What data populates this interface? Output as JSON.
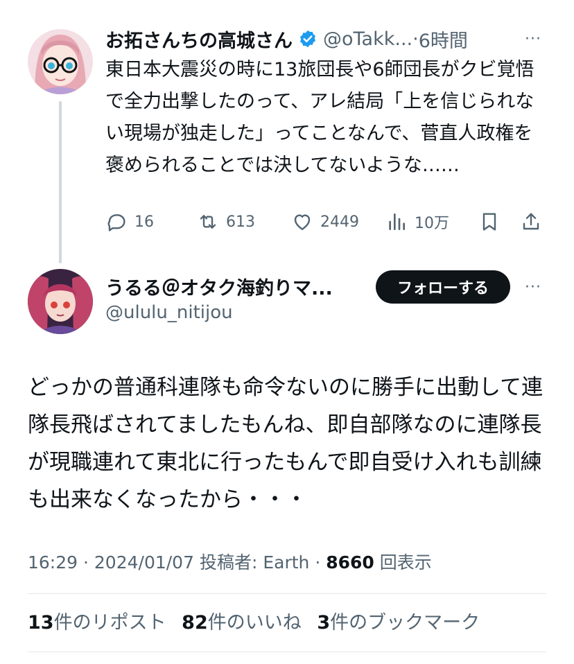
{
  "tweet1": {
    "display_name": "お拓さんちの高城さん",
    "handle": "@oTakk...",
    "separator": "·",
    "time": "6時間",
    "text": "東日本大震災の時に13旅団長や6師団長がクビ覚悟で全力出撃したのって、アレ結局「上を信じられない現場が独走した」ってことなんで、菅直人政権を褒められることでは決してないような……",
    "replies": "16",
    "reposts": "613",
    "likes": "2449",
    "views": "10万",
    "more": "···"
  },
  "tweet2": {
    "display_name": "うるる＠オタク海釣りマ...",
    "handle": "@ululu_nitijou",
    "follow_label": "フォローする",
    "more": "···",
    "text": "どっかの普通科連隊も命令ないのに勝手に出動して連隊長飛ばされてましたもんね、即自部隊なのに連隊長が現職連れて東北に行ったもんで即自受け入れも訓練も出来なくなったから・・・",
    "time": "16:29",
    "date": "2024/01/07",
    "posted_by_label": "投稿者: Earth",
    "view_count": "8660",
    "view_label": "回表示",
    "repost_count": "13",
    "repost_label": "件のリポスト",
    "like_count": "82",
    "like_label": "件のいいね",
    "bookmark_count": "3",
    "bookmark_label": "件のブックマーク"
  },
  "colors": {
    "text": "#0f1419",
    "secondary": "#536471",
    "verified": "#1d9bf0",
    "button_bg": "#0f1419",
    "divider": "#e3e8eb"
  },
  "icons": [
    "reply-icon",
    "repost-icon",
    "like-icon",
    "views-icon",
    "bookmark-icon",
    "share-icon",
    "verified-badge-icon",
    "more-icon"
  ]
}
